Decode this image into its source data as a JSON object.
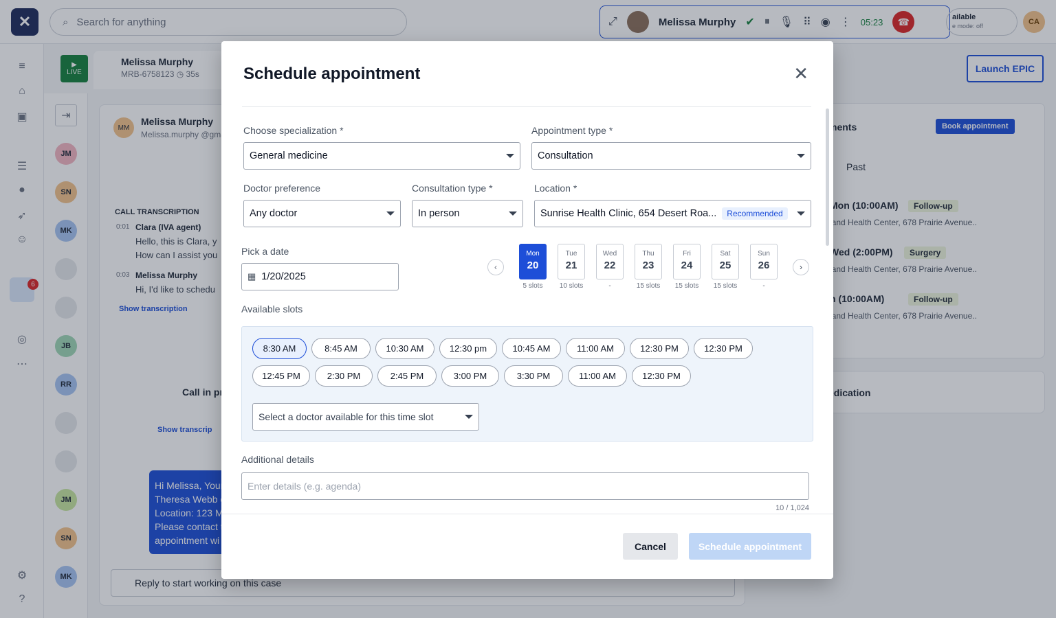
{
  "topbar": {
    "search_placeholder": "Search for anything",
    "call": {
      "name": "Melissa Murphy",
      "timer": "05:23"
    },
    "availability": {
      "status": "ailable",
      "mode": "e mode: off"
    },
    "user_initials": "CA"
  },
  "case_tab": {
    "live_label": "LIVE",
    "name": "Melissa Murphy",
    "id": "MRB-6758123",
    "duration": "35s"
  },
  "launch_epic": "Launch EPIC",
  "conversation_avatars": [
    {
      "initials": "JM",
      "color": "#f4b6c2"
    },
    {
      "initials": "SN",
      "color": "#f3c38b"
    },
    {
      "initials": "MK",
      "color": "#a7c4f2"
    },
    {
      "initials": "",
      "color": "#e5e7eb"
    },
    {
      "initials": "",
      "color": "#e5e7eb"
    },
    {
      "initials": "JB",
      "color": "#9fd8b5"
    },
    {
      "initials": "RR",
      "color": "#a7c4f2"
    },
    {
      "initials": "",
      "color": "#e5e7eb"
    },
    {
      "initials": "",
      "color": "#e5e7eb"
    },
    {
      "initials": "JM",
      "color": "#c8e6a0"
    },
    {
      "initials": "SN",
      "color": "#f3c38b"
    },
    {
      "initials": "MK",
      "color": "#a7c4f2"
    }
  ],
  "notification_count": "6",
  "background_panel": {
    "contact_initials": "MM",
    "contact_name": "Melissa Murphy",
    "contact_email": "Melissa.murphy @gma",
    "transcription_heading": "CALL TRANSCRIPTION",
    "lines": [
      {
        "time": "0:01",
        "speaker": "Clara (IVA agent)",
        "text1": "Hello, this is Clara, y",
        "text2": "How can I assist you"
      },
      {
        "time": "0:03",
        "speaker": "Melissa Murphy",
        "text1": "Hi, I'd like to schedu",
        "text2": ""
      }
    ],
    "show_transcription": "Show transcription",
    "call_in_progress": "Call in pr",
    "show_transcription_2": "Show transcrip",
    "message_lines": [
      "Hi Melissa, Your",
      "Theresa Webb o",
      "Location: 123 M",
      "Please contact t",
      "appointment wi"
    ],
    "reply_placeholder": "Reply to start working on this case"
  },
  "right_panel": {
    "title": "ments",
    "book_button": "Book appointment",
    "tab_past": "Past",
    "appointments": [
      {
        "when": "Mon (10:00AM)",
        "tag": "Follow-up",
        "place": "land Health Center, 678 Prairie Avenue.."
      },
      {
        "when": "Wed (2:00PM)",
        "tag": "Surgery",
        "place": "land Health Center, 678 Prairie Avenue.."
      },
      {
        "when": "n (10:00AM)",
        "tag": "Follow-up",
        "place": "land Health Center, 678 Prairie Avenue.."
      }
    ],
    "medication": "edication"
  },
  "modal": {
    "title": "Schedule appointment",
    "specialization": {
      "label": "Choose specialization",
      "value": "General medicine"
    },
    "appointment_type": {
      "label": "Appointment type",
      "value": "Consultation"
    },
    "doctor_preference": {
      "label": "Doctor preference",
      "value": "Any doctor"
    },
    "consultation_type": {
      "label": "Consultation type",
      "value": "In person"
    },
    "location": {
      "label": "Location",
      "value": "Sunrise Health Clinic, 654 Desert Roa...",
      "badge": "Recommended"
    },
    "required_mark": "*",
    "pick_date": {
      "label": "Pick a date",
      "value": "1/20/2025"
    },
    "days": [
      {
        "dow": "Mon",
        "num": "20",
        "slots": "5 slots",
        "active": true
      },
      {
        "dow": "Tue",
        "num": "21",
        "slots": "10 slots",
        "active": false
      },
      {
        "dow": "Wed",
        "num": "22",
        "slots": "-",
        "active": false
      },
      {
        "dow": "Thu",
        "num": "23",
        "slots": "15 slots",
        "active": false
      },
      {
        "dow": "Fri",
        "num": "24",
        "slots": "15 slots",
        "active": false
      },
      {
        "dow": "Sat",
        "num": "25",
        "slots": "15 slots",
        "active": false
      },
      {
        "dow": "Sun",
        "num": "26",
        "slots": "-",
        "active": false
      }
    ],
    "available_slots_label": "Available slots",
    "slots_row1": [
      "8:30 AM",
      "8:45 AM",
      "10:30 AM",
      "12:30 pm",
      "10:45 AM",
      "11:00 AM",
      "12:30 PM",
      "12:30 PM"
    ],
    "slots_row2": [
      "12:45 PM",
      "2:30 PM",
      "2:45 PM",
      "3:00 PM",
      "3:30 PM",
      "11:00 AM",
      "12:30 PM"
    ],
    "selected_slot": "8:30 AM",
    "doctor_select_placeholder": "Select a doctor available for this time slot",
    "additional_details_label": "Additional details",
    "details_placeholder": "Enter details (e.g. agenda)",
    "char_counter": "10 / 1,024",
    "cancel": "Cancel",
    "submit": "Schedule appointment"
  },
  "colors": {
    "primary": "#1d4ed8",
    "live": "#15803d",
    "danger": "#dc2626"
  }
}
